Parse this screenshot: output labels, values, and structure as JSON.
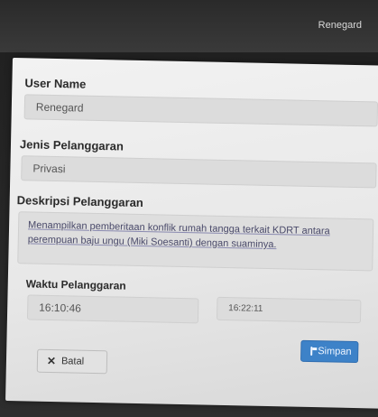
{
  "topbar": {
    "username": "Renegard"
  },
  "form": {
    "user_name_label": "User Name",
    "user_name_value": "Renegard",
    "jenis_label": "Jenis Pelanggaran",
    "jenis_value": "Privasi",
    "deskripsi_label": "Deskripsi Pelanggaran",
    "deskripsi_value": "Menampilkan pemberitaan konflik rumah tangga terkait KDRT antara perempuan baju ungu (Miki Soesanti) dengan suaminya.",
    "waktu_label": "Waktu Pelanggaran",
    "waktu_start": "16:10:46",
    "waktu_end": "16:22:11"
  },
  "buttons": {
    "cancel_label": "Batal",
    "save_label": "Simpan"
  },
  "icons": {
    "cancel": "close-icon",
    "save": "floppy-disk-icon"
  },
  "colors": {
    "save_button": "#3d82c8",
    "panel": "#ececec",
    "background": "#2b2b2b"
  }
}
